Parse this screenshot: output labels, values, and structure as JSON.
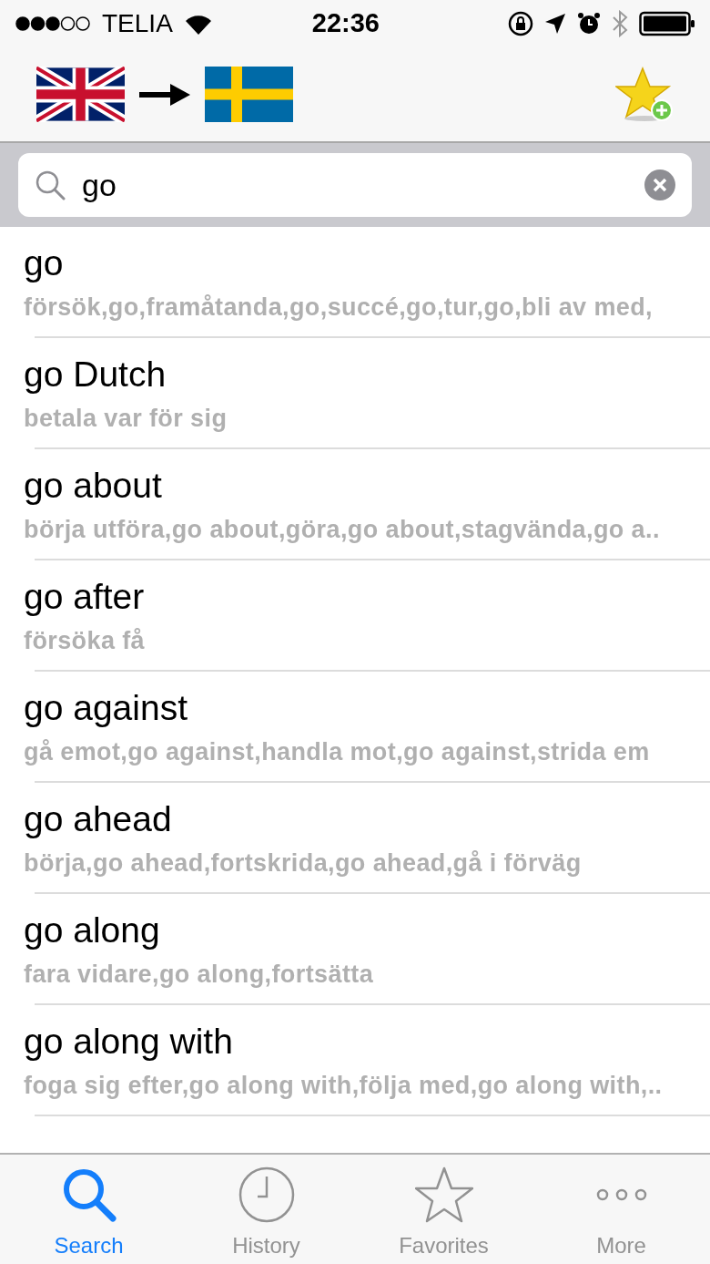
{
  "status_bar": {
    "carrier": "TELIA",
    "time": "22:36"
  },
  "search": {
    "value": "go"
  },
  "results": [
    {
      "word": "go",
      "translation": "försök,go,framåtanda,go,succé,go,tur,go,bli av med,"
    },
    {
      "word": "go Dutch",
      "translation": "betala var för sig"
    },
    {
      "word": "go about",
      "translation": "börja utföra,go about,göra,go about,stagvända,go a.."
    },
    {
      "word": "go after",
      "translation": "försöka få"
    },
    {
      "word": "go against",
      "translation": "gå emot,go against,handla mot,go against,strida em"
    },
    {
      "word": "go ahead",
      "translation": "börja,go ahead,fortskrida,go ahead,gå i förväg"
    },
    {
      "word": "go along",
      "translation": "fara vidare,go along,fortsätta"
    },
    {
      "word": "go along with",
      "translation": "foga sig efter,go along with,följa med,go along with,.."
    }
  ],
  "tabs": [
    {
      "kind": "search",
      "label": "Search",
      "selected": true
    },
    {
      "kind": "history",
      "label": "History",
      "selected": false
    },
    {
      "kind": "favorites",
      "label": "Favorites",
      "selected": false
    },
    {
      "kind": "more",
      "label": "More",
      "selected": false
    }
  ]
}
